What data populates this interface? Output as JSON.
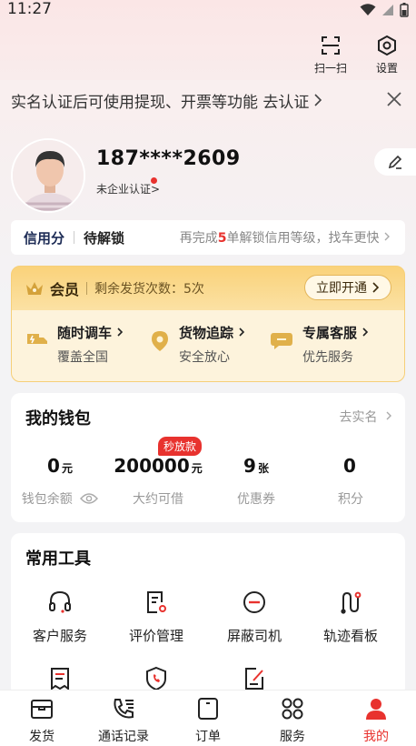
{
  "status_bar": {
    "time": "11:27"
  },
  "top_actions": {
    "scan_label": "扫一扫",
    "settings_label": "设置"
  },
  "notice": {
    "text": "实名认证后可使用提现、开票等功能 去认证"
  },
  "profile": {
    "phone": "187****2609",
    "enterprise": "未企业认证>"
  },
  "credit": {
    "label": "信用分",
    "status": "待解锁",
    "hint_pre": "再完成",
    "hint_num": "5",
    "hint_post": "单解锁信用等级，找车更快"
  },
  "membership": {
    "title": "会员",
    "remaining": "剩余发货次数：5次",
    "open_label": "立即开通",
    "features": [
      {
        "title": "随时调车",
        "subtitle": "覆盖全国"
      },
      {
        "title": "货物追踪",
        "subtitle": "安全放心"
      },
      {
        "title": "专属客服",
        "subtitle": "优先服务"
      }
    ]
  },
  "wallet": {
    "title": "我的钱包",
    "verify_link": "去实名",
    "badge": "秒放款",
    "items": [
      {
        "value": "0",
        "unit": "元",
        "label": "钱包余额"
      },
      {
        "value": "200000",
        "unit": "元",
        "label": "大约可借"
      },
      {
        "value": "9",
        "unit": "张",
        "label": "优惠券"
      },
      {
        "value": "0",
        "unit": "",
        "label": "积分"
      }
    ]
  },
  "tools": {
    "title": "常用工具",
    "items": [
      {
        "label": "客户服务"
      },
      {
        "label": "评价管理"
      },
      {
        "label": "屏蔽司机"
      },
      {
        "label": "轨迹看板"
      }
    ]
  },
  "tabbar": {
    "items": [
      {
        "label": "发货"
      },
      {
        "label": "通话记录"
      },
      {
        "label": "订单"
      },
      {
        "label": "服务"
      },
      {
        "label": "我的"
      }
    ]
  },
  "colors": {
    "accent": "#e8322e",
    "gold": "#fad27a",
    "navy": "#1c2b55"
  }
}
